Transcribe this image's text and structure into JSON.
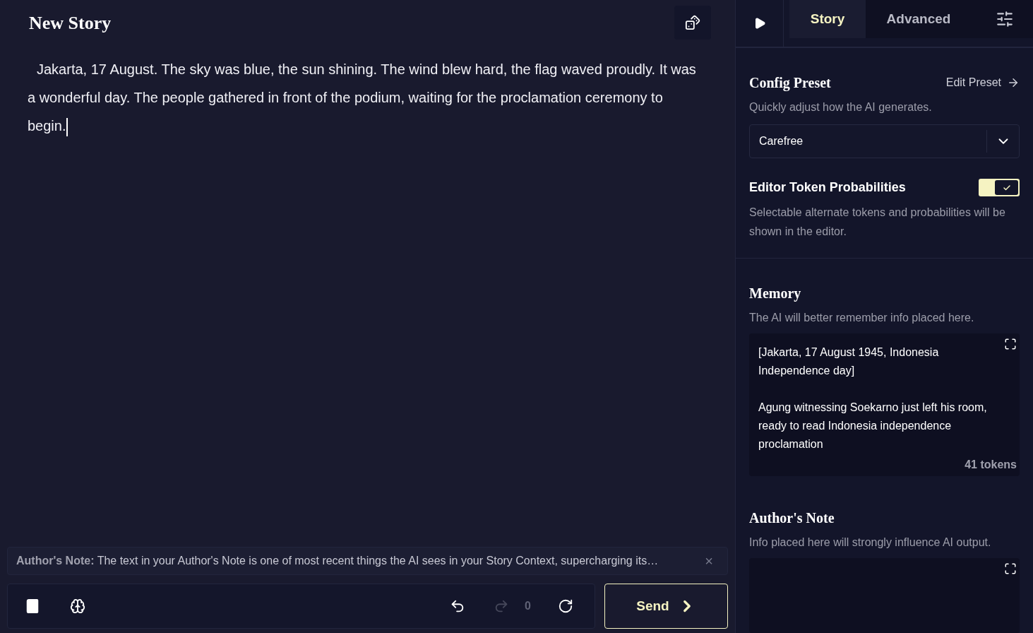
{
  "story": {
    "title": "New Story",
    "text": "Jakarta, 17 August. The sky was blue, the sun shining. The wind blew hard, the flag waved proudly. It was a wonderful day. The people gathered in front of the podium, waiting for the proclamation ceremony to begin."
  },
  "notice": {
    "text": "**Author's Note:** The text in your Author's Note is one of most recent things the AI sees in your Story Context, supercharging its…",
    "close": "×"
  },
  "toolbar": {
    "undo_disabled": false,
    "redo_disabled": true,
    "count": "0",
    "send": "Send"
  },
  "tabs": [
    {
      "label": "Story",
      "selected": true
    },
    {
      "label": "Advanced",
      "selected": false
    }
  ],
  "config_preset": {
    "title": "Config Preset",
    "edit": "Edit Preset",
    "description": "Quickly adjust how the AI generates.",
    "value": "Carefree"
  },
  "editor_token_probabilities": {
    "title": "Editor Token Probabilities",
    "on": true,
    "description": "Selectable alternate tokens and probabilities will be shown in the editor."
  },
  "memory": {
    "title": "Memory",
    "description": "The AI will better remember info placed here.",
    "paragraphs": [
      "[Jakarta, 17 August 1945, Indonesia Independence day]",
      "Agung witnessing Soekarno just left his room, ready to read Indonesia independence proclamation"
    ],
    "tokens": "41 tokens"
  },
  "authors_note": {
    "title": "Author's Note",
    "description": "Info placed here will strongly influence AI output."
  }
}
